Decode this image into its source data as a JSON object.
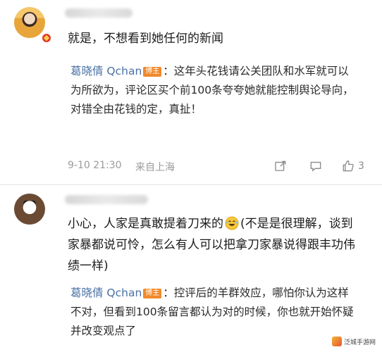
{
  "comments": [
    {
      "body": "就是，不想看到她任何的新闻",
      "reply": {
        "name": "葛晓倩 Qchan",
        "badge": "博主",
        "text": "：这年头花钱请公关团队和水军就可以为所欲为，评论区买个前100条夸夸她就能控制舆论导向，对错全由花钱的定，真扯！"
      },
      "meta": {
        "time": "9-10 21:30",
        "location": "来自上海",
        "like_count": "3"
      }
    },
    {
      "body_before": "小心，人家是真敢提着刀来的",
      "body_after": "(不是是很理解，谈到家暴都说可怜，怎么有人可以把拿刀家暴说得跟丰功伟绩一样)",
      "reply": {
        "name": "葛晓倩 Qchan",
        "badge": "博主",
        "text": "：控评后的羊群效应，哪怕你认为这样不对，但看到100条留言都认为对的时候，你也就开始怀疑并改变观点了"
      }
    }
  ],
  "watermark": "泛城手游网",
  "colors": {
    "reply_name": "#4a72a6",
    "host_badge": "#f08a2c",
    "meta_text": "#9a9a9a",
    "verified_badge": "#e5372b"
  },
  "icons": {
    "share": "share-icon",
    "comment": "comment-icon",
    "like": "thumbs-up-icon",
    "emoji": "laughing-emoji-icon"
  }
}
